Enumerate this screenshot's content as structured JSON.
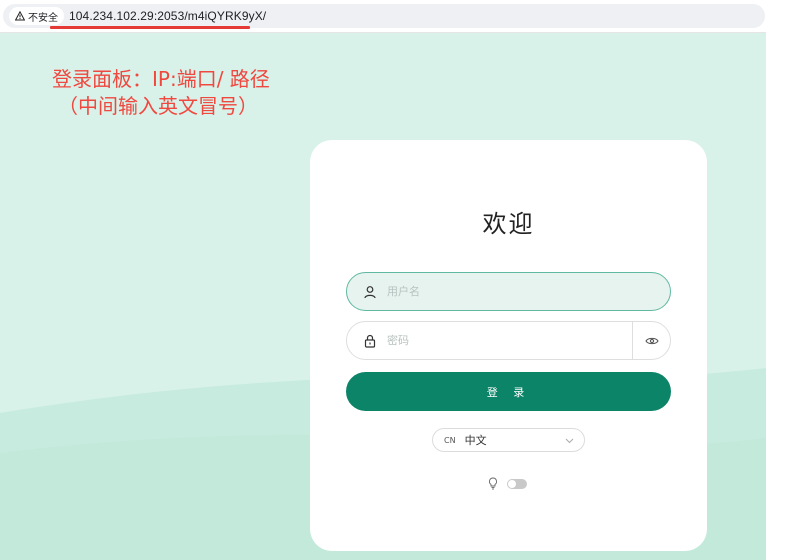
{
  "browser": {
    "security_label": "不安全",
    "url": "104.234.102.29:2053/m4iQYRK9yX/"
  },
  "annotation": {
    "line1": "登录面板：IP:端口/ 路径",
    "line2": "（中间输入英文冒号）"
  },
  "login": {
    "title": "欢迎",
    "username_placeholder": "用户名",
    "password_placeholder": "密码",
    "login_button": "登 录",
    "language_code": "CN",
    "language_label": "中文"
  },
  "colors": {
    "background": "#d8f2e9",
    "accent": "#0b8468",
    "annotation": "#f0473f",
    "url_underline": "#e53935"
  },
  "icons": [
    "warning-icon",
    "user-icon",
    "lock-icon",
    "eye-icon",
    "chevron-down-icon",
    "lightbulb-icon"
  ]
}
